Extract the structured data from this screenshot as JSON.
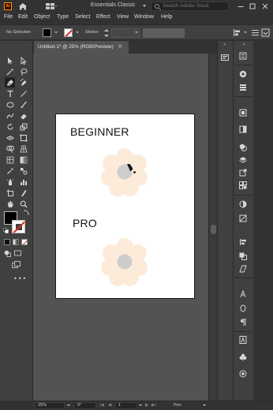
{
  "app": {
    "logo_text": "Ai",
    "workspace": "Essentials Classic",
    "search_placeholder": "Search Adobe Stock",
    "window_controls": [
      "minimize-icon",
      "maximize-icon",
      "close-icon"
    ]
  },
  "menu": [
    "File",
    "Edit",
    "Object",
    "Type",
    "Select",
    "Effect",
    "View",
    "Window",
    "Help"
  ],
  "control_bar": {
    "selection": "No Selection",
    "stroke_label": "Stroke:",
    "fill_color": "#000000",
    "stroke_color": "none"
  },
  "document": {
    "tab_title": "Untitled-1* @ 25% (RGB/Preview)",
    "close_glyph": "×"
  },
  "artboard": {
    "label_top": "BEGINNER",
    "label_bottom": "PRO",
    "flower_petal_color": "#fdebd9",
    "flower_center_color": "#cdcdcd",
    "background": "#ffffff"
  },
  "status": {
    "zoom": "25%",
    "rotation": "0°",
    "artboard_number": "1",
    "tool_name": "Pen"
  },
  "tools": [
    "selection-tool",
    "direct-selection-tool",
    "magic-wand-tool",
    "lasso-tool",
    "pen-tool",
    "curvature-tool",
    "type-tool",
    "line-tool",
    "rectangle-tool",
    "paintbrush-tool",
    "shaper-tool",
    "eraser-tool",
    "rotate-tool",
    "scale-tool",
    "width-tool",
    "free-transform-tool",
    "shape-builder-tool",
    "perspective-grid-tool",
    "mesh-tool",
    "gradient-tool",
    "eyedropper-tool",
    "blend-tool",
    "symbol-sprayer-tool",
    "column-graph-tool",
    "artboard-tool",
    "slice-tool",
    "hand-tool",
    "zoom-tool"
  ],
  "colors": {
    "ui_dark": "#323232",
    "ui_panel": "#404040",
    "canvas": "#535353",
    "logo_orange": "#ff9a00",
    "stroke_none_red": "#e0261b"
  }
}
